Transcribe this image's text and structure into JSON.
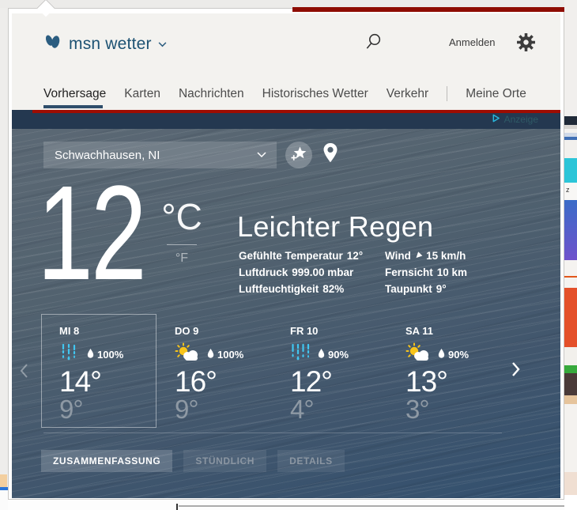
{
  "header": {
    "logo_text": "msn wetter",
    "signin_label": "Anmelden"
  },
  "nav": {
    "tabs": [
      {
        "label": "Vorhersage",
        "active": true
      },
      {
        "label": "Karten",
        "active": false
      },
      {
        "label": "Nachrichten",
        "active": false
      },
      {
        "label": "Historisches Wetter",
        "active": false
      },
      {
        "label": "Verkehr",
        "active": false
      },
      {
        "label": "Meine Orte",
        "active": false
      }
    ]
  },
  "ad": {
    "label": "Anzeige"
  },
  "weather": {
    "location": "Schwachhausen, NI",
    "current": {
      "temp": "12",
      "unit_primary": "°C",
      "unit_secondary": "°F",
      "condition": "Leichter Regen",
      "details_left": [
        {
          "label": "Gefühlte Temperatur",
          "value": "12°"
        },
        {
          "label": "Luftdruck",
          "value": "999.00 mbar"
        },
        {
          "label": "Luftfeuchtigkeit",
          "value": "82%"
        }
      ],
      "details_right": [
        {
          "label": "Wind",
          "value": "15 km/h",
          "icon": "wind-direction-arrow"
        },
        {
          "label": "Fernsicht",
          "value": "10 km"
        },
        {
          "label": "Taupunkt",
          "value": "9°"
        }
      ]
    },
    "forecast": [
      {
        "day": "MI 8",
        "icon": "rain-icon",
        "precip": "100%",
        "high": "14°",
        "low": "9°",
        "selected": true
      },
      {
        "day": "DO 9",
        "icon": "sun-cloud-icon",
        "precip": "100%",
        "high": "16°",
        "low": "9°",
        "selected": false
      },
      {
        "day": "FR 10",
        "icon": "rain-icon",
        "precip": "90%",
        "high": "12°",
        "low": "4°",
        "selected": false
      },
      {
        "day": "SA 11",
        "icon": "sun-cloud-icon",
        "precip": "90%",
        "high": "13°",
        "low": "3°",
        "selected": false
      }
    ],
    "view_tabs": [
      {
        "label": "ZUSAMMENFASSUNG",
        "active": true
      },
      {
        "label": "STÜNDLICH",
        "active": false
      },
      {
        "label": "DETAILS",
        "active": false
      }
    ]
  },
  "background_edge": {
    "fragment_text": "z"
  },
  "colors": {
    "brand_blue": "#2b5d80",
    "brand_navy": "#2e4d6b",
    "accent_red": "#9d0c02",
    "navy": "#243850",
    "rain_cyan": "#41c6f0",
    "sun_yellow": "#f8c41a",
    "ad_cyan": "#29b7dd",
    "low_temp_gray": "#8e99a4"
  }
}
